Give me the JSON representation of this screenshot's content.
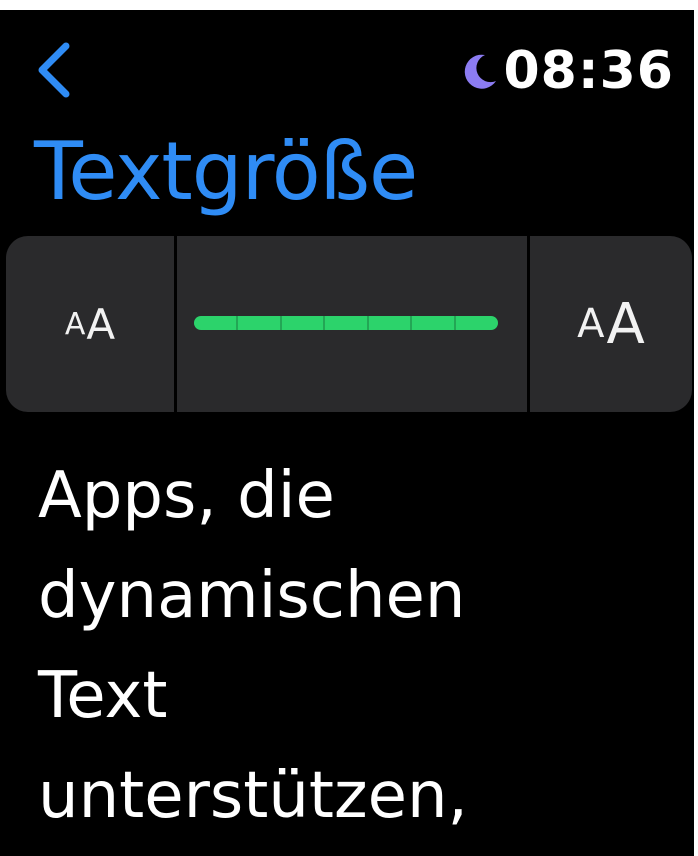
{
  "header": {
    "back_icon": "chevron-left-icon",
    "focus_icon": "moon-icon",
    "time": "08:36",
    "title": "Textgröße"
  },
  "colors": {
    "title": "#2f8cf5",
    "moon": "#8c7cf2",
    "level": "#2cd36b",
    "background": "#000000",
    "control": "#2a2a2c"
  },
  "text_size": {
    "decrease_label": {
      "small": "A",
      "big": "A"
    },
    "increase_label": {
      "small": "A",
      "big": "A"
    },
    "level": 7,
    "max_level": 7
  },
  "preview": {
    "lines": [
      "Apps, die",
      "dynamischen",
      "Text",
      "unterstützen,"
    ]
  }
}
